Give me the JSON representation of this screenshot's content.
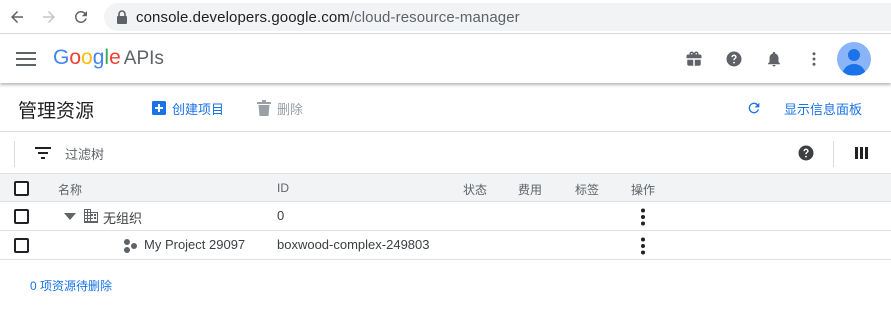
{
  "browser": {
    "url_host": "console.developers.google.com",
    "url_path": "/cloud-resource-manager"
  },
  "header": {
    "logo_google": "Google",
    "logo_apis": "APIs",
    "logo_colors": [
      "#4285F4",
      "#EA4335",
      "#FBBC05",
      "#4285F4",
      "#34A853",
      "#EA4335"
    ]
  },
  "toolbar": {
    "title": "管理资源",
    "create_label": "创建项目",
    "delete_label": "删除",
    "info_panel_label": "显示信息面板"
  },
  "filter": {
    "placeholder": "过滤树"
  },
  "table": {
    "columns": {
      "name": "名称",
      "id": "ID",
      "status": "状态",
      "billing": "费用",
      "labels": "标签",
      "actions": "操作"
    },
    "rows": [
      {
        "name": "无组织",
        "id": "0",
        "icon": "organization-icon",
        "expanded": true
      },
      {
        "name": "My Project 29097",
        "id": "boxwood-complex-249803",
        "icon": "project-icon"
      }
    ]
  },
  "footer": {
    "pending_delete": "0 项资源待删除"
  },
  "colors": {
    "accent": "#1a73e8",
    "icon": "#5f6368",
    "disabled": "#9aa0a6"
  }
}
